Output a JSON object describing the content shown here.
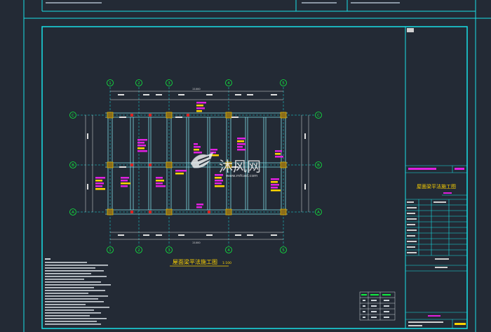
{
  "drawing": {
    "title": "屋面梁平法施工图",
    "scale": "1:100",
    "project_title": "屋面梁平法施工图",
    "watermark_brand": "沐风网",
    "watermark_url": "www.mfcad.com",
    "axes_columns": [
      "1",
      "2",
      "3",
      "4",
      "5"
    ],
    "axes_rows": [
      "C",
      "B",
      "A"
    ],
    "top_total_dim": "21000",
    "bottom_total_dim": "21000"
  },
  "colors": {
    "background": "#232a35",
    "frame": "#19e0e6",
    "beam": "#7fe0ea",
    "axis": "#10ee40",
    "dimension": "#e0e0e0",
    "annotation": "#e020e0",
    "column": "#e0b000",
    "title_text": "#ffd400"
  },
  "icons": {
    "watermark_logo": "mf-logo-icon"
  }
}
